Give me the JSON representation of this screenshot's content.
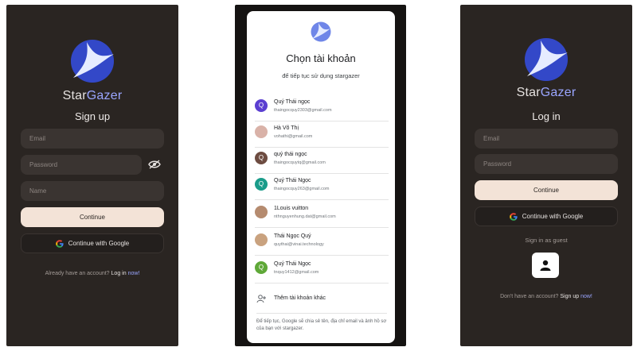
{
  "brand": {
    "part1": "Star",
    "part2": "Gazer"
  },
  "signup": {
    "title": "Sign up",
    "email_placeholder": "Email",
    "password_placeholder": "Password",
    "name_placeholder": "Name",
    "continue_label": "Continue",
    "google_label": "Continue with Google",
    "footer_text": "Already have an account?",
    "footer_link_a": "Log in",
    "footer_link_b": "now!"
  },
  "picker": {
    "title": "Chọn tài khoản",
    "subtitle": "để tiếp tục sử dụng stargazer",
    "accounts": [
      {
        "initial": "Q",
        "color": "#5b3fd1",
        "name": "Quý Thái ngọc",
        "email": "thaingocquy2303@gmail.com"
      },
      {
        "initial": "",
        "color": "#d9b2a8",
        "name": "Hà Võ Thị",
        "email": "vohathi@gmail.com"
      },
      {
        "initial": "Q",
        "color": "#6d4c41",
        "name": "quý thái ngọc",
        "email": "thaingocquytq@gmail.com"
      },
      {
        "initial": "Q",
        "color": "#1a9c8a",
        "name": "Quý Thái Ngọc",
        "email": "thaingocquy263@gmail.com"
      },
      {
        "initial": "",
        "color": "#b58b6f",
        "name": "1Louis vuitton",
        "email": "nthnguyenhung.dat@gmail.com"
      },
      {
        "initial": "",
        "color": "#c9a27f",
        "name": "Thái Ngọc Quý",
        "email": "quythai@vinai.technology"
      },
      {
        "initial": "Q",
        "color": "#5fa838",
        "name": "Quý Thái Ngọc",
        "email": "tnquy1412@gmail.com"
      }
    ],
    "add_account": "Thêm tài khoản khác",
    "disclaimer": "Để tiếp tục, Google sẽ chia sẻ tên, địa chỉ email và ảnh hồ sơ của bạn với stargazer."
  },
  "login": {
    "title": "Log in",
    "email_placeholder": "Email",
    "password_placeholder": "Password",
    "continue_label": "Continue",
    "google_label": "Continue with Google",
    "guest_label": "Sign in as guest",
    "footer_text": "Don't have an account?",
    "footer_link_a": "Sign up",
    "footer_link_b": "now!"
  }
}
